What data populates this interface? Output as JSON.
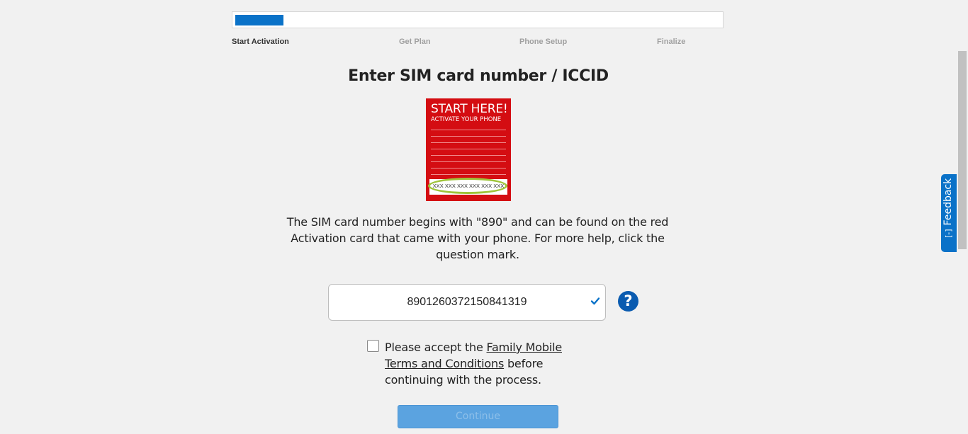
{
  "progress": {
    "percent": 10
  },
  "steps": [
    {
      "label": "Start Activation",
      "active": true
    },
    {
      "label": "Get Plan",
      "active": false
    },
    {
      "label": "Phone Setup",
      "active": false
    },
    {
      "label": "Finalize",
      "active": false
    }
  ],
  "page_title": "Enter SIM card number / ICCID",
  "sim_card": {
    "heading": "START HERE!",
    "subheading": "ACTIVATE YOUR PHONE",
    "number_mask": "XXX XXX XXX XXX XXX XXX"
  },
  "description": "The SIM card number begins with \"890\" and can be found on the red Activation card that came with your phone. For more help, click the question mark.",
  "sim_input": {
    "value": "8901260372150841319"
  },
  "help_icon": {
    "glyph": "?"
  },
  "terms": {
    "prefix": "Please accept the ",
    "link": "Family Mobile Terms and Conditions",
    "suffix": " before continuing with the process.",
    "checked": false
  },
  "continue_button": {
    "label": "Continue",
    "enabled": false
  },
  "feedback": {
    "label": "Feedback",
    "icon": "[-]"
  },
  "colors": {
    "accent": "#0a72c8",
    "card_red": "#d40d12",
    "button_disabled": "#5ba3e0"
  }
}
